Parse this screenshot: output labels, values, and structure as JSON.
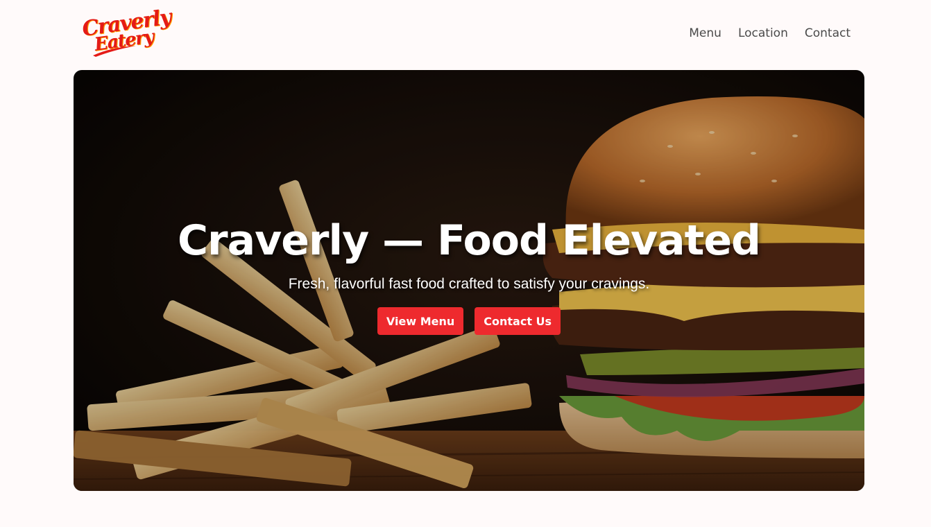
{
  "brand": {
    "logo_line1": "Craverly",
    "logo_line2": "Eatery",
    "logo_color": "#e41b17"
  },
  "nav": {
    "items": [
      {
        "label": "Menu"
      },
      {
        "label": "Location"
      },
      {
        "label": "Contact"
      }
    ]
  },
  "hero": {
    "title": "Craverly — Food Elevated",
    "subtitle": "Fresh, flavorful fast food crafted to satisfy your cravings.",
    "buttons": {
      "view_menu": "View Menu",
      "contact_us": "Contact Us"
    },
    "button_color": "#ee2a2e",
    "image": "burger-and-fries-photo"
  }
}
